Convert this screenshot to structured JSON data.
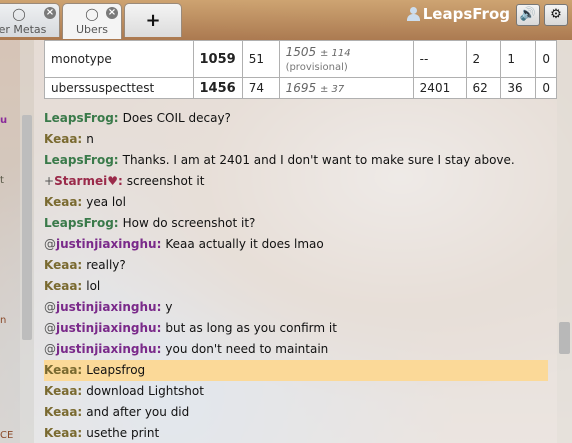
{
  "header": {
    "tabs": [
      {
        "label": "her Metas",
        "icon": "chat-bubble-icon"
      },
      {
        "label": "Ubers",
        "icon": "chat-bubble-icon",
        "active": true
      },
      {
        "label": "+"
      }
    ],
    "close_glyph": "×",
    "username": "LeapsFrog",
    "sound_icon": "🔊",
    "gear_icon": "⚙"
  },
  "ladder": [
    {
      "format": "monotype",
      "elo": "1059",
      "gxe": "51",
      "glicko": "1505",
      "glicko_dev": "± 114",
      "note": "(provisional)",
      "coil": "--",
      "w": "2",
      "l": "1",
      "t": "0"
    },
    {
      "format": "uberssuspecttest",
      "elo": "1456",
      "gxe": "74",
      "glicko": "1695",
      "glicko_dev": "± 37",
      "note": "",
      "coil": "2401",
      "w": "62",
      "l": "36",
      "t": "0"
    }
  ],
  "left_panel_bits": [
    "u",
    "t",
    "n",
    "CE"
  ],
  "messages": [
    {
      "rank": "",
      "user": "LeapsFrog:",
      "color": "#3a7a4a",
      "text": "Does COIL decay?"
    },
    {
      "rank": "",
      "user": "Keaa:",
      "color": "#7a6a30",
      "text": "n"
    },
    {
      "rank": "",
      "user": "LeapsFrog:",
      "color": "#3a7a4a",
      "text": "Thanks. I am at 2401 and I don't want to make sure I stay above."
    },
    {
      "rank": "+",
      "user": "Starmei♥:",
      "color": "#9a2a4a",
      "text": "screenshot it"
    },
    {
      "rank": "",
      "user": "Keaa:",
      "color": "#7a6a30",
      "text": "yea lol"
    },
    {
      "rank": "",
      "user": "LeapsFrog:",
      "color": "#3a7a4a",
      "text": "How do screenshot it?"
    },
    {
      "rank": "@",
      "user": "justinjiaxinghu:",
      "color": "#7a2a8a",
      "text": "Keaa actually it does lmao"
    },
    {
      "rank": "",
      "user": "Keaa:",
      "color": "#7a6a30",
      "text": "really?"
    },
    {
      "rank": "",
      "user": "Keaa:",
      "color": "#7a6a30",
      "text": "lol"
    },
    {
      "rank": "@",
      "user": "justinjiaxinghu:",
      "color": "#7a2a8a",
      "text": "y"
    },
    {
      "rank": "@",
      "user": "justinjiaxinghu:",
      "color": "#7a2a8a",
      "text": "but as long as you confirm it"
    },
    {
      "rank": "@",
      "user": "justinjiaxinghu:",
      "color": "#7a2a8a",
      "text": "you don't need to maintain"
    },
    {
      "rank": "",
      "user": "Keaa:",
      "color": "#7a6a30",
      "text": "Leapsfrog",
      "highlight": true
    },
    {
      "rank": "",
      "user": "Keaa:",
      "color": "#7a6a30",
      "text": "download Lightshot"
    },
    {
      "rank": "",
      "user": "Keaa:",
      "color": "#7a6a30",
      "text": "and after you did"
    },
    {
      "rank": "",
      "user": "Keaa:",
      "color": "#7a6a30",
      "text": "usethe print"
    }
  ]
}
